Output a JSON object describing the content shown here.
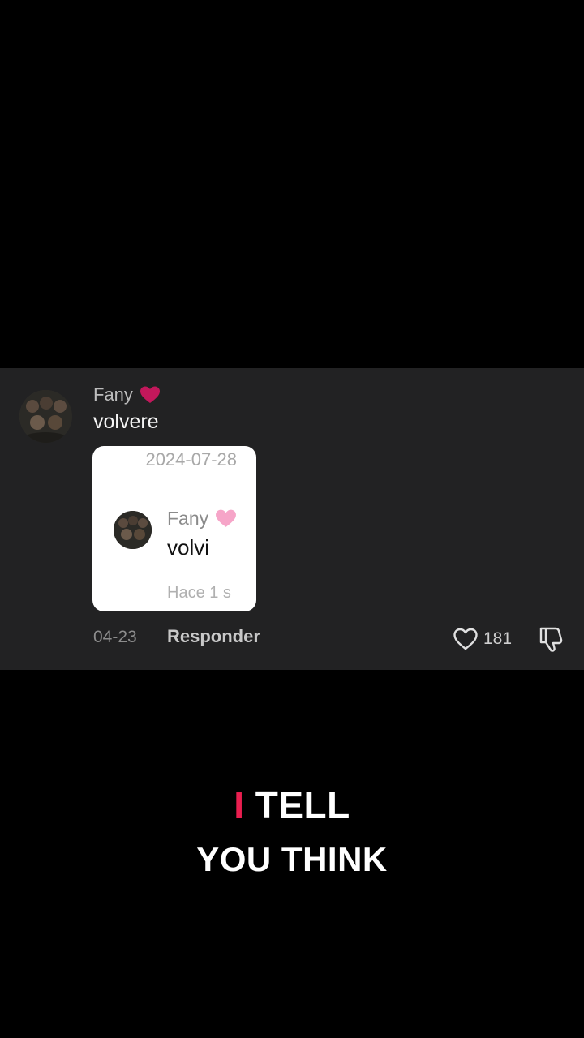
{
  "comment": {
    "username": "Fany",
    "username_emoji": "heart-emoji-magenta",
    "text": "volvere",
    "date": "04-23",
    "reply_label": "Responder",
    "like_count": "181"
  },
  "reply_card": {
    "date": "2024-07-28",
    "username": "Fany",
    "username_emoji": "heart-emoji-pink",
    "text": "volvi",
    "time": "Hace 1 s"
  },
  "caption": {
    "line1_accent": "I",
    "line1_rest": "TELL",
    "line2": "YOU THINK"
  },
  "colors": {
    "panel_background": "#222223",
    "page_background": "#000000",
    "caption_accent": "#e91e4f",
    "heart_magenta": "#c2185b",
    "heart_pink": "#f6a5c8"
  },
  "icons": {
    "like": "heart-outline-icon",
    "dislike": "thumbs-down-icon"
  }
}
